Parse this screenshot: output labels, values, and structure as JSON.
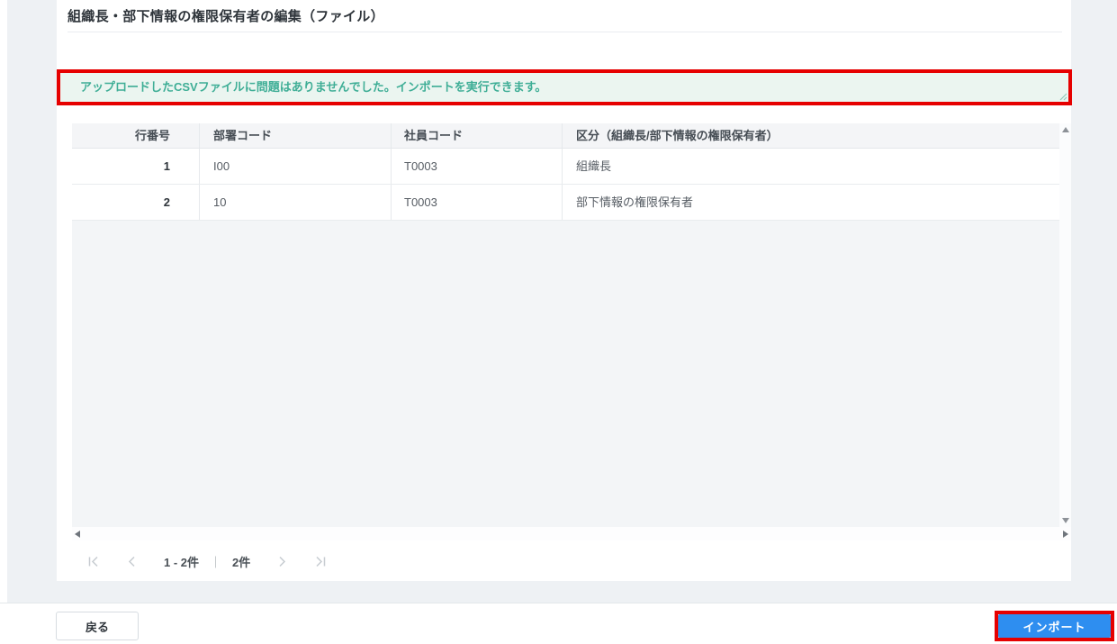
{
  "header": {
    "title": "組織長・部下情報の権限保有者の編集（ファイル）"
  },
  "message": {
    "text": "アップロードしたCSVファイルに問題はありませんでした。インポートを実行できます。"
  },
  "table": {
    "columns": [
      "行番号",
      "部署コード",
      "社員コード",
      "区分（組織長/部下情報の権限保有者）"
    ],
    "rows": [
      [
        "1",
        "I00",
        "T0003",
        "組織長"
      ],
      [
        "2",
        "10",
        "T0003",
        "部下情報の権限保有者"
      ]
    ]
  },
  "pagination": {
    "range": "1 - 2件",
    "separator": "｜",
    "total": "2件"
  },
  "footer": {
    "back": "戻る",
    "import": "インポート"
  },
  "colors": {
    "accent_blue": "#2e8ef0",
    "annotation_red": "#e60000",
    "message_bg": "#ebf5f0",
    "message_text": "#3fae96",
    "header_bg": "#f4f5f7"
  },
  "icons": [
    "first-page-icon",
    "prev-page-icon",
    "next-page-icon",
    "last-page-icon",
    "scroll-up-icon",
    "scroll-down-icon",
    "scroll-left-icon",
    "scroll-right-icon",
    "resize-grip-icon"
  ]
}
